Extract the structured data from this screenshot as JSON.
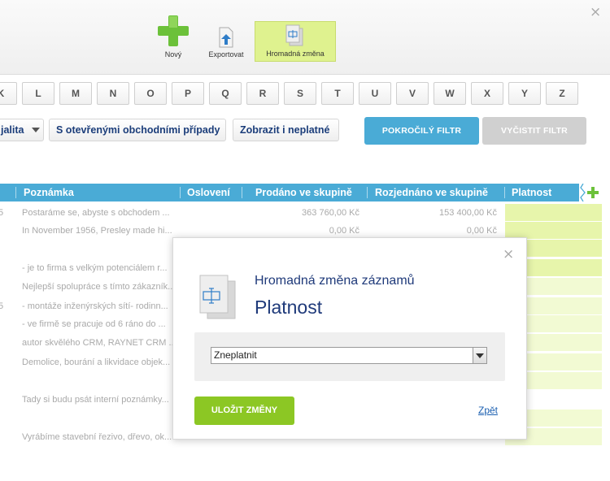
{
  "toolbar": {
    "new_label": "Nový",
    "export_label": "Exportovat",
    "bulk_label": "Hromadná změna"
  },
  "letters": [
    "K",
    "L",
    "M",
    "N",
    "O",
    "P",
    "Q",
    "R",
    "S",
    "T",
    "U",
    "V",
    "W",
    "X",
    "Y",
    "Z"
  ],
  "filters": {
    "partial_left": "jalita",
    "open_cases": "S otevřenými obchodními případy",
    "show_invalid": "Zobrazit i neplatné",
    "advanced": "POKROČILÝ FILTR",
    "clear": "VYČISTIT FILTR"
  },
  "grid": {
    "columns": [
      "Poznámka",
      "Oslovení",
      "Prodáno ve skupině",
      "Rozjednáno ve skupině",
      "Platnost"
    ],
    "rows": [
      {
        "prefix": "5",
        "note": "Postaráme se, abyste s obchodem ...",
        "sold": "363 760,00 Kč",
        "negotiated": "153 400,00 Kč"
      },
      {
        "prefix": "",
        "note": "In November 1956, Presley made hi...",
        "sold": "0,00 Kč",
        "negotiated": "0,00 Kč"
      },
      {
        "prefix": "",
        "note": "",
        "sold": "",
        "negotiated": ""
      },
      {
        "prefix": "",
        "note": "- je to firma s velkým potenciálem r...",
        "sold": "",
        "negotiated": ""
      },
      {
        "prefix": "",
        "note": "Nejlepší spolupráce s tímto zákazník...",
        "sold": "",
        "negotiated": ""
      },
      {
        "prefix": "5",
        "note": "- montáže inženýrských sítí- rodinn...",
        "sold": "",
        "negotiated": ""
      },
      {
        "prefix": "",
        "note": "- ve firmě se pracuje od 6 ráno do ...",
        "sold": "",
        "negotiated": ""
      },
      {
        "prefix": "",
        "note": "autor skvělého CRM, RAYNET CRM ...",
        "sold": "",
        "negotiated": ""
      },
      {
        "prefix": "",
        "note": "Demolice, bourání a likvidace objek...",
        "sold": "",
        "negotiated": ""
      },
      {
        "prefix": "",
        "note": "",
        "sold": "",
        "negotiated": ""
      },
      {
        "prefix": "",
        "note": "Tady si budu psát interní poznámky...",
        "sold": "",
        "negotiated": ""
      },
      {
        "prefix": "",
        "note": "",
        "sold": "",
        "negotiated": ""
      },
      {
        "prefix": "",
        "note": "Vyrábíme stavební řezivo, dřevo, ok...",
        "sold": "",
        "negotiated": ""
      }
    ]
  },
  "modal": {
    "subtitle": "Hromadná změna záznamů",
    "title": "Platnost",
    "select_value": "Zneplatnit",
    "save_label": "ULOŽIT ZMĚNY",
    "back_label": "Zpět"
  },
  "colors": {
    "header_blue": "#4aabd6",
    "advanced_btn": "#4aabd6",
    "clear_btn": "#d0d0d0",
    "validity_green_strong": "#dff28f",
    "validity_green_light": "#eef8c4",
    "save_green": "#8cc724",
    "plus_green": "#6cc13a",
    "title_blue": "#1f3a7a"
  }
}
